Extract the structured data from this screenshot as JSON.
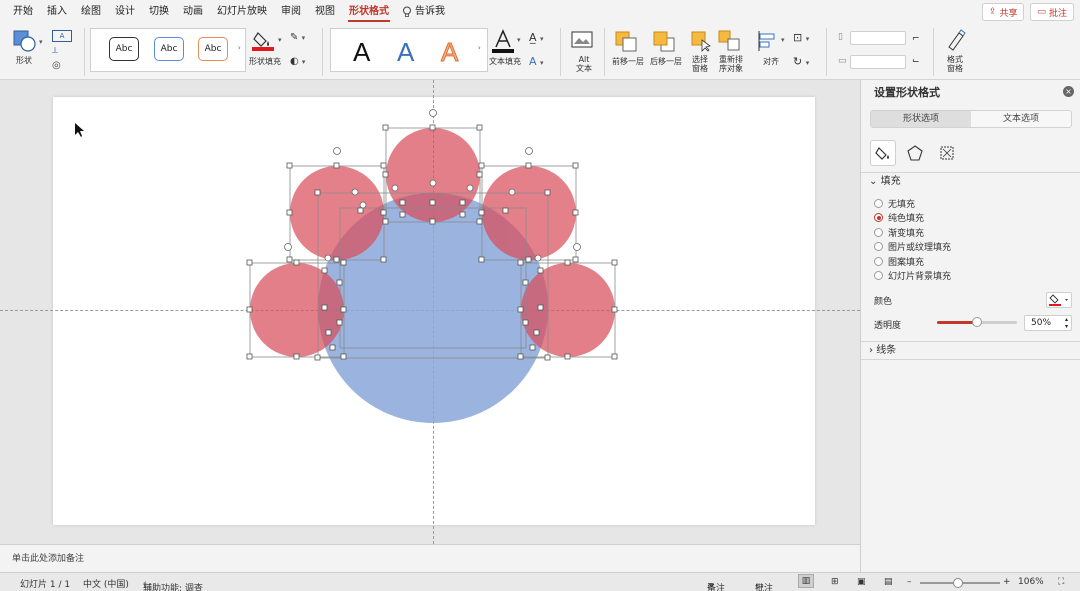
{
  "menu": {
    "tabs": [
      "开始",
      "插入",
      "绘图",
      "设计",
      "切换",
      "动画",
      "幻灯片放映",
      "审阅",
      "视图",
      "形状格式"
    ],
    "active_tab": "形状格式",
    "tell_me": "告诉我",
    "share": "共享",
    "comments": "批注"
  },
  "ribbon": {
    "shapes_label": "形状",
    "style_sample": "Abc",
    "shape_fill_label": "形状填充",
    "wordart_letter": "A",
    "text_fill_label": "文本填充",
    "alt_text_label_1": "Alt",
    "alt_text_label_2": "文本",
    "bring_forward": "前移一层",
    "send_backward": "后移一层",
    "selection_pane_1": "选择",
    "selection_pane_2": "窗格",
    "reorder_1": "重新排",
    "reorder_2": "序对象",
    "align": "对齐",
    "format_pane_1": "格式",
    "format_pane_2": "窗格"
  },
  "notes_placeholder": "单击此处添加备注",
  "panel": {
    "title": "设置形状格式",
    "seg_shape": "形状选项",
    "seg_text": "文本选项",
    "fill_section": "填充",
    "fill_options": [
      "无填充",
      "纯色填充",
      "渐变填充",
      "图片或纹理填充",
      "图案填充",
      "幻灯片背景填充"
    ],
    "fill_selected_index": 1,
    "color_label": "颜色",
    "transparency_label": "透明度",
    "transparency_value": "50%",
    "transparency_fraction": 0.5,
    "line_section": "线条"
  },
  "status": {
    "slide_info": "幻灯片 1 / 1",
    "language": "中文 (中国)",
    "accessibility": "辅助功能: 调查",
    "notes": "备注",
    "comments": "批注",
    "zoom": "106%",
    "zoom_fraction": 0.47
  },
  "colors": {
    "accent": "#c0392b",
    "red_circle": "#d9534f",
    "blue_circle": "#7f9fd6"
  }
}
